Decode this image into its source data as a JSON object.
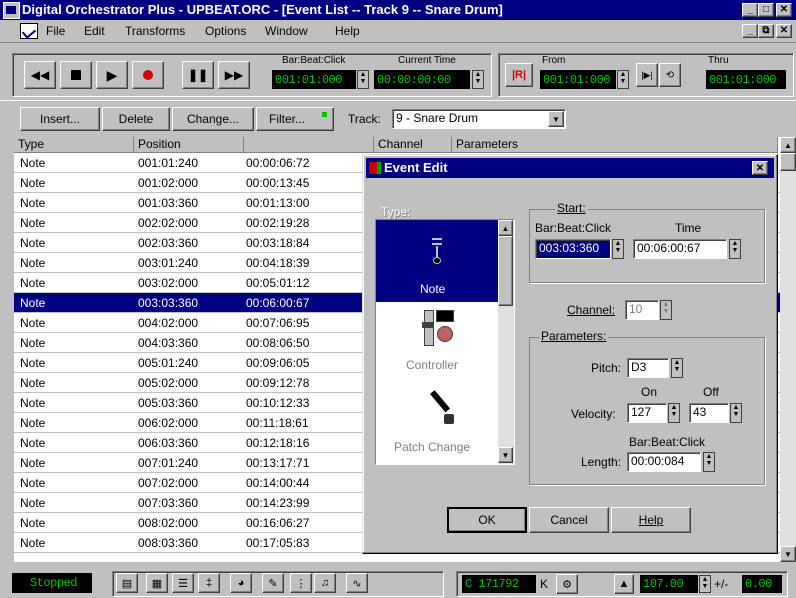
{
  "window": {
    "title": "Digital Orchestrator Plus - UPBEAT.ORC - [Event List -- Track 9 -- Snare Drum]",
    "min_icon": "minimize-icon",
    "max_icon": "maximize-icon",
    "close_icon": "close-icon"
  },
  "menu": [
    "File",
    "Edit",
    "Transforms",
    "Options",
    "Window",
    "Help"
  ],
  "transport": {
    "bar_beat_click_label": "Bar:Beat:Click",
    "bar_beat_click_value": "001:01:000",
    "current_time_label": "Current Time",
    "current_time_value": "00:00:00:00",
    "from_label": "From",
    "from_value": "001:01:000",
    "thru_label": "Thru",
    "thru_value": "001:01:000"
  },
  "toolbar": {
    "insert": "Insert...",
    "delete": "Delete",
    "change": "Change...",
    "filter": "Filter...",
    "track_label": "Track:",
    "track_value": "9 - Snare Drum"
  },
  "table": {
    "headers": [
      "Type",
      "Position",
      "",
      "Channel",
      "Parameters"
    ],
    "rows": [
      {
        "type": "Note",
        "pos": "001:01:240",
        "time": "00:00:06:72"
      },
      {
        "type": "Note",
        "pos": "001:02:000",
        "time": "00:00:13:45"
      },
      {
        "type": "Note",
        "pos": "001:03:360",
        "time": "00:01:13:00"
      },
      {
        "type": "Note",
        "pos": "002:02:000",
        "time": "00:02:19:28"
      },
      {
        "type": "Note",
        "pos": "002:03:360",
        "time": "00:03:18:84"
      },
      {
        "type": "Note",
        "pos": "003:01:240",
        "time": "00:04:18:39"
      },
      {
        "type": "Note",
        "pos": "003:02:000",
        "time": "00:05:01:12"
      },
      {
        "type": "Note",
        "pos": "003:03:360",
        "time": "00:06:00:67",
        "selected": true
      },
      {
        "type": "Note",
        "pos": "004:02:000",
        "time": "00:07:06:95"
      },
      {
        "type": "Note",
        "pos": "004:03:360",
        "time": "00:08:06:50"
      },
      {
        "type": "Note",
        "pos": "005:01:240",
        "time": "00:09:06:05"
      },
      {
        "type": "Note",
        "pos": "005:02:000",
        "time": "00:09:12:78"
      },
      {
        "type": "Note",
        "pos": "005:03:360",
        "time": "00:10:12:33"
      },
      {
        "type": "Note",
        "pos": "006:02:000",
        "time": "00:11:18:61"
      },
      {
        "type": "Note",
        "pos": "006:03:360",
        "time": "00:12:18:16"
      },
      {
        "type": "Note",
        "pos": "007:01:240",
        "time": "00:13:17:71"
      },
      {
        "type": "Note",
        "pos": "007:02:000",
        "time": "00:14:00:44"
      },
      {
        "type": "Note",
        "pos": "007:03:360",
        "time": "00:14:23:99"
      },
      {
        "type": "Note",
        "pos": "008:02:000",
        "time": "00:16:06:27"
      },
      {
        "type": "Note",
        "pos": "008:03:360",
        "time": "00:17:05:83"
      }
    ]
  },
  "dialog": {
    "title": "Event Edit",
    "type_label": "Type:",
    "types": [
      "Note",
      "Controller",
      "Patch Change"
    ],
    "start_label": "Start:",
    "bbc_label": "Bar:Beat:Click",
    "bbc_value": "003:03:360",
    "time_label": "Time",
    "time_value": "00:06:00:67",
    "channel_label": "Channel:",
    "channel_value": "10",
    "parameters_label": "Parameters:",
    "pitch_label": "Pitch:",
    "pitch_value": "D3",
    "on_label": "On",
    "off_label": "Off",
    "velocity_label": "Velocity:",
    "velocity_on": "127",
    "velocity_off": "43",
    "length_bbc_label": "Bar:Beat:Click",
    "length_label": "Length:",
    "length_value": "00:00:084",
    "ok": "OK",
    "cancel": "Cancel",
    "help": "Help"
  },
  "status": {
    "state": "Stopped",
    "counter": "C 171792",
    "k": "K",
    "tempo": "107.00",
    "plus_minus": "+/-",
    "offset": "0.00"
  }
}
